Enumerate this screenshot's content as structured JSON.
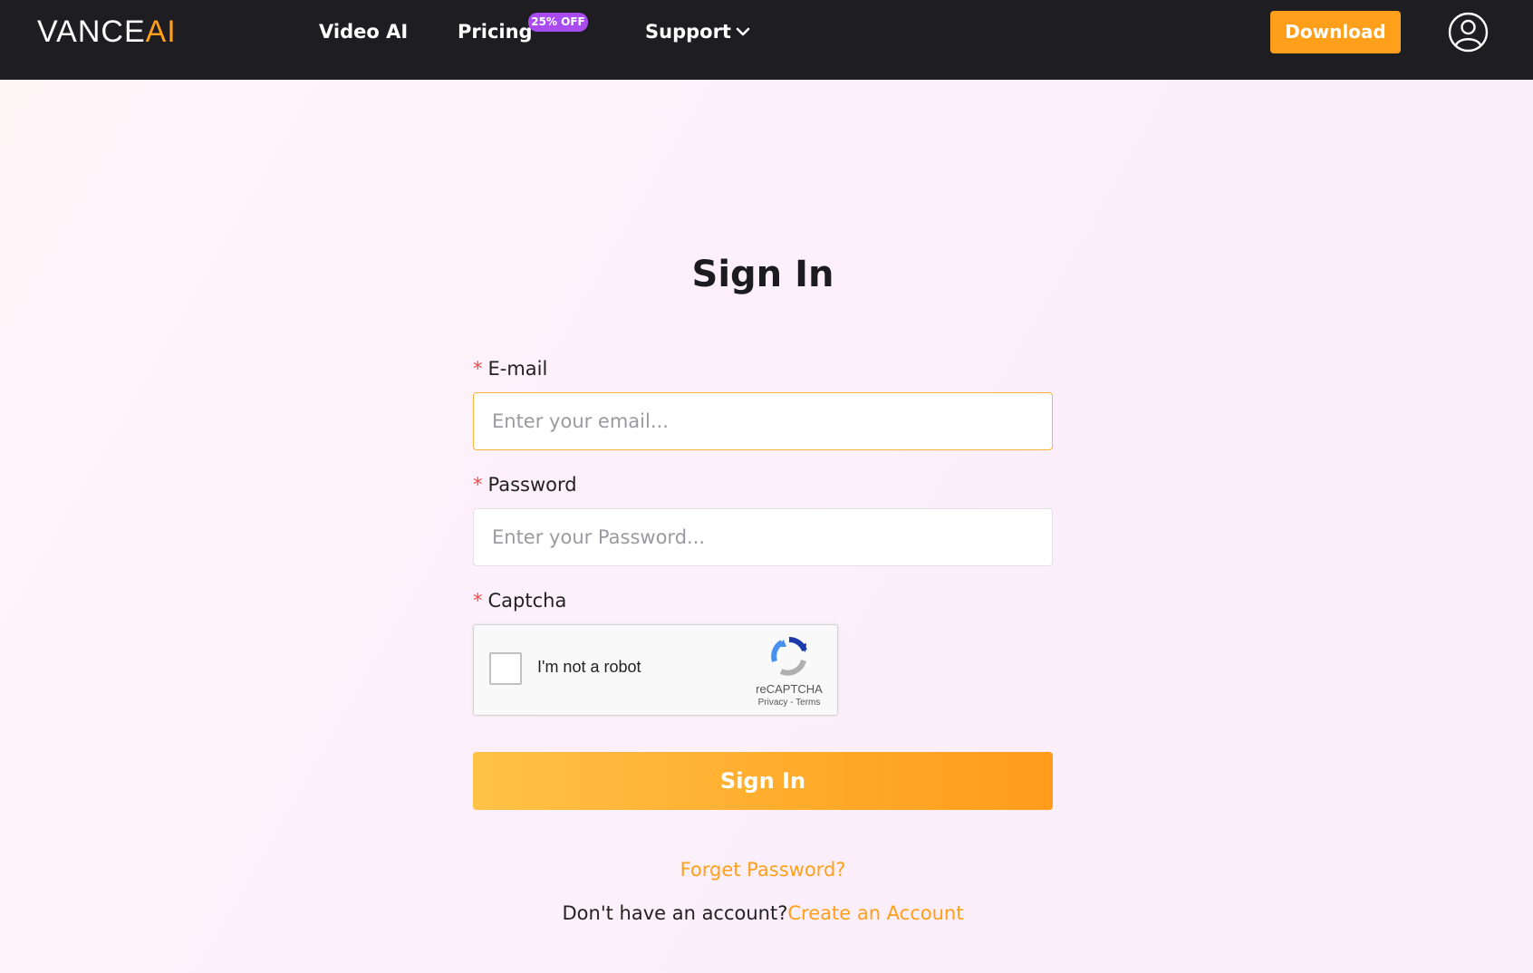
{
  "nav": {
    "logo_main": "VANCE",
    "logo_ai": "AI",
    "video_ai": "Video AI",
    "pricing": "Pricing",
    "pricing_badge": "25% OFF",
    "support": "Support",
    "download": "Download"
  },
  "form": {
    "title": "Sign In",
    "required_mark": "*",
    "email_label": "E-mail",
    "email_placeholder": "Enter your email...",
    "password_label": "Password",
    "password_placeholder": "Enter your Password...",
    "captcha_label": "Captcha",
    "submit": "Sign In",
    "forget_password": "Forget Password?",
    "no_account_text": "Don't have an account?",
    "create_account": "Create an Account"
  },
  "recaptcha": {
    "checkbox_text": "I'm not a robot",
    "brand": "reCAPTCHA",
    "privacy": "Privacy",
    "separator": " - ",
    "terms": "Terms"
  },
  "colors": {
    "accent": "#ff9f1a",
    "navbar": "#1d1d22",
    "badge": "#a84cf0",
    "required": "#f04a4a"
  },
  "icons": {
    "support_dropdown": "chevron-down-icon",
    "account": "user-circle-icon",
    "recaptcha": "recaptcha-logo-icon"
  }
}
